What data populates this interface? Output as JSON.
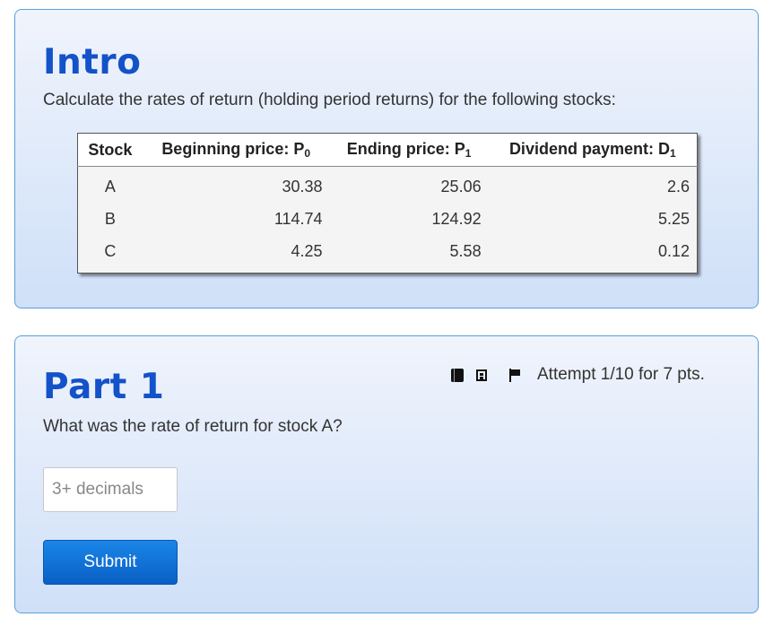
{
  "intro": {
    "title": "Intro",
    "text": "Calculate the rates of return (holding period returns) for the following stocks:"
  },
  "table": {
    "headers": [
      {
        "label": "Stock",
        "sub": ""
      },
      {
        "label": "Beginning price: P",
        "sub": "0"
      },
      {
        "label": "Ending price: P",
        "sub": "1"
      },
      {
        "label": "Dividend payment: D",
        "sub": "1"
      }
    ],
    "rows": [
      [
        "A",
        "30.38",
        "25.06",
        "2.6"
      ],
      [
        "B",
        "114.74",
        "124.92",
        "5.25"
      ],
      [
        "C",
        "4.25",
        "5.58",
        "0.12"
      ]
    ]
  },
  "part": {
    "title": "Part 1",
    "question": "What was the rate of return for stock A?",
    "attempt": "Attempt 1/10 for 7 pts.",
    "input_placeholder": "3+ decimals",
    "input_value": "",
    "submit_label": "Submit"
  },
  "icons": [
    "book-icon",
    "film-icon",
    "flag-icon"
  ],
  "colors": {
    "heading": "#1352c8",
    "card_border": "#5aa0d8",
    "button": "#0a5fc4"
  }
}
